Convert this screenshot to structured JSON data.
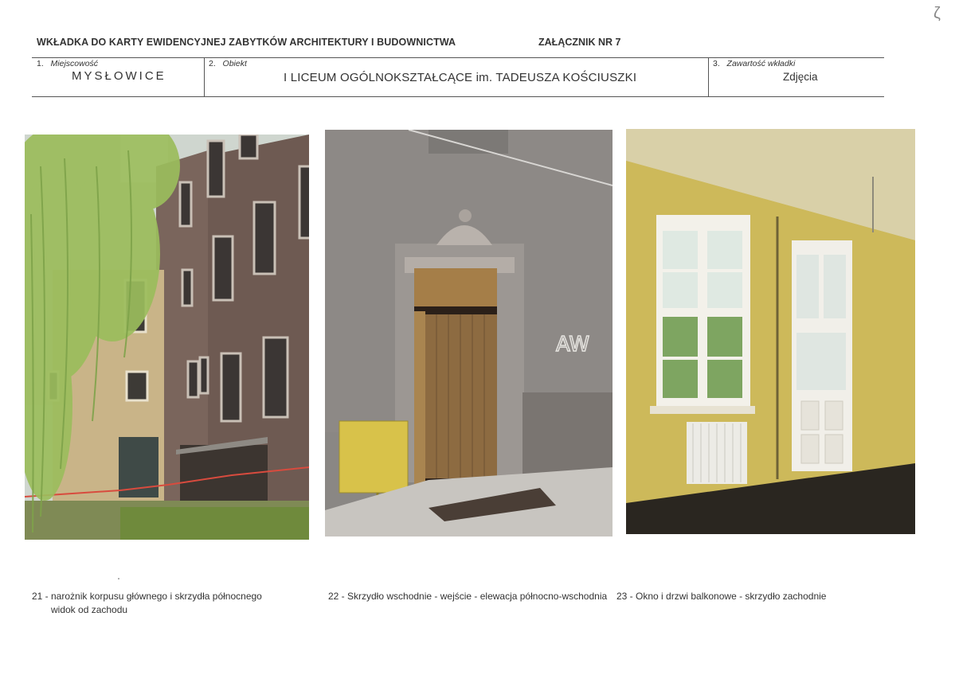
{
  "header": {
    "title": "WKŁADKA DO KARTY EWIDENCYJNEJ ZABYTKÓW ARCHITEKTURY I BUDOWNICTWA",
    "attachment": "ZAŁĄCZNIK NR  7",
    "corner_mark": "ζ"
  },
  "fields": {
    "place_num": "1.",
    "place_label": "Miejscowość",
    "place_value": "MYSŁOWICE",
    "object_num": "2.",
    "object_label": "Obiekt",
    "object_value": "I LICEUM OGÓLNOKSZTAŁCĄCE im. TADEUSZA KOŚCIUSZKI",
    "content_num": "3.",
    "content_label": "Zawartość wkładki",
    "content_value": "Zdjęcia"
  },
  "photos": [
    {
      "icon": "building-corner-photo",
      "caption_line1": "21 - narożnik korpusu głównego i skrzydła północnego",
      "caption_line2": "widok od zachodu"
    },
    {
      "icon": "entrance-door-photo",
      "caption_line1": "22 - Skrzydło wschodnie - wejście - elewacja północno-wschodnia"
    },
    {
      "icon": "interior-window-photo",
      "caption_line1": "23 - Okno i drzwi balkonowe - skrzydło zachodnie"
    }
  ]
}
